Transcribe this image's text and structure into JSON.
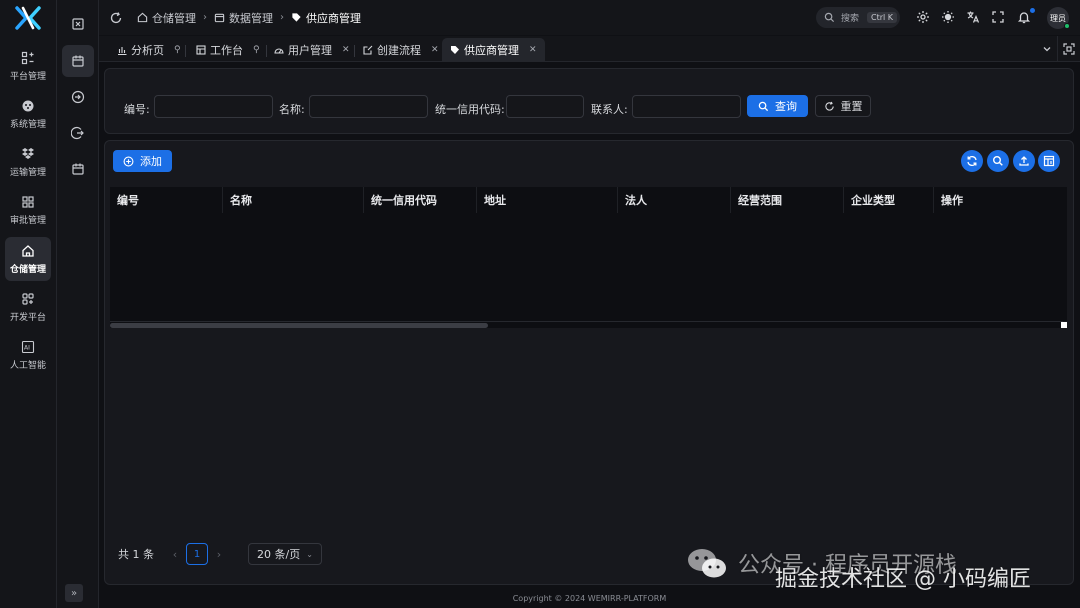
{
  "sidebar": {
    "items": [
      {
        "label": "平台管理",
        "icon": "platform-icon"
      },
      {
        "label": "系统管理",
        "icon": "system-icon"
      },
      {
        "label": "运输管理",
        "icon": "dropbox-icon"
      },
      {
        "label": "审批管理",
        "icon": "grid-icon"
      },
      {
        "label": "仓储管理",
        "icon": "home-icon",
        "active": true
      },
      {
        "label": "开发平台",
        "icon": "apps-icon"
      },
      {
        "label": "人工智能",
        "icon": "ai-icon"
      }
    ]
  },
  "header": {
    "breadcrumbs": [
      "仓储管理",
      "数据管理",
      "供应商管理"
    ],
    "search_label": "搜索",
    "search_shortcut": "Ctrl K",
    "avatar_text": "理员"
  },
  "tabs": [
    {
      "label": "分析页",
      "kind": "pin"
    },
    {
      "label": "工作台",
      "kind": "pin"
    },
    {
      "label": "用户管理",
      "kind": "close"
    },
    {
      "label": "创建流程",
      "kind": "close"
    },
    {
      "label": "供应商管理",
      "kind": "close",
      "active": true
    }
  ],
  "filters": {
    "code_label": "编号:",
    "name_label": "名称:",
    "credit_label": "统一信用代码:",
    "contact_label": "联系人:",
    "code_value": "",
    "name_value": "",
    "credit_value": "",
    "contact_value": "",
    "query_label": "查询",
    "reset_label": "重置"
  },
  "toolbar": {
    "add_label": "添加"
  },
  "table": {
    "columns": [
      "编号",
      "名称",
      "统一信用代码",
      "地址",
      "法人",
      "经营范围",
      "企业类型",
      "操作"
    ],
    "rows": []
  },
  "pagination": {
    "total_text": "共 1 条",
    "current_page": "1",
    "page_size": "20 条/页"
  },
  "footer": {
    "copyright": "Copyright © 2024 WEMIRR-PLATFORM"
  },
  "watermark": {
    "line1": "公众号 · 程序员开源栈",
    "line2": "掘金技术社区 @ 小码编匠"
  },
  "colors": {
    "accent": "#1c6fe6",
    "background": "#0f1014",
    "panel": "#17181d",
    "online": "#1fbf6b"
  }
}
